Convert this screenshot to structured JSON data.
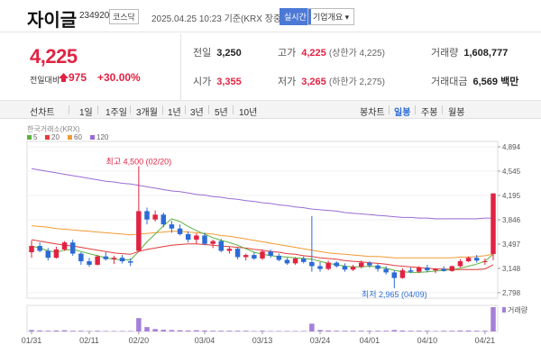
{
  "header": {
    "stock_name": "자이글",
    "stock_code": "234920",
    "market": "코스닥",
    "timestamp": "2025.04.25 10:23  기준(KRX 장중)",
    "realtime_label": "실시간",
    "company_info_label": "기업개요 ▾"
  },
  "price": {
    "current": "4,225",
    "prev_label": "전일대비",
    "change": "975",
    "change_pct": "+30.00%",
    "up_color": "#e12343"
  },
  "stats": {
    "prev_close": {
      "label": "전일",
      "value": "3,250"
    },
    "open": {
      "label": "시가",
      "value": "3,355"
    },
    "high": {
      "label": "고가",
      "value": "4,225",
      "sub": "(상한가 4,225)"
    },
    "low": {
      "label": "저가",
      "value": "3,265",
      "sub": "(하한가 2,275)"
    },
    "volume": {
      "label": "거래량",
      "value": "1,608,777"
    },
    "amount": {
      "label": "거래대금",
      "value": "6,569",
      "unit": "백만"
    }
  },
  "tabs": {
    "period": [
      "선차트",
      "1일",
      "1주일",
      "3개월",
      "1년",
      "3년",
      "5년",
      "10년"
    ],
    "candle": [
      "봉차트",
      "일봉",
      "주봉",
      "월봉"
    ],
    "active_candle": "일봉"
  },
  "chart_data": {
    "type": "candlestick",
    "source_label": "한국거래소(KRX)",
    "legend": [
      {
        "name": "5",
        "color": "#5ab33a"
      },
      {
        "name": "20",
        "color": "#e23b3b"
      },
      {
        "name": "60",
        "color": "#f39a32"
      },
      {
        "name": "120",
        "color": "#9a6bd6"
      }
    ],
    "y_ticks": [
      4894,
      4545,
      4195,
      3846,
      3497,
      3148,
      2798
    ],
    "y_tick_labels": [
      "4,894",
      "4,545",
      "4,195",
      "3,846",
      "3,497",
      "3,148",
      "2,798"
    ],
    "ylim": [
      2798,
      4894
    ],
    "x_tick_labels": [
      "01/31",
      "02/11",
      "02/20",
      "03/04",
      "03/13",
      "03/24",
      "04/01",
      "04/10",
      "04/21"
    ],
    "x_tick_index": [
      0,
      7,
      13,
      21,
      28,
      35,
      41,
      48,
      55
    ],
    "annotations": {
      "high": "최고 4,500 (02/20)",
      "low": "최저 2,965 (04/09)"
    },
    "volume_label": "거래량",
    "candles": [
      [
        3380,
        3550,
        3300,
        3470
      ],
      [
        3470,
        3520,
        3380,
        3400
      ],
      [
        3400,
        3440,
        3260,
        3300
      ],
      [
        3300,
        3460,
        3290,
        3420
      ],
      [
        3420,
        3540,
        3400,
        3520
      ],
      [
        3520,
        3560,
        3330,
        3360
      ],
      [
        3360,
        3380,
        3200,
        3250
      ],
      [
        3250,
        3300,
        3170,
        3200
      ],
      [
        3200,
        3340,
        3190,
        3320
      ],
      [
        3320,
        3380,
        3260,
        3280
      ],
      [
        3280,
        3330,
        3210,
        3300
      ],
      [
        3300,
        3340,
        3220,
        3250
      ],
      [
        3250,
        3290,
        3180,
        3230
      ],
      [
        3400,
        4500,
        3380,
        3970
      ],
      [
        3970,
        4020,
        3780,
        3850
      ],
      [
        3850,
        3980,
        3820,
        3920
      ],
      [
        3920,
        3950,
        3740,
        3780
      ],
      [
        3780,
        3830,
        3660,
        3720
      ],
      [
        3720,
        3780,
        3620,
        3640
      ],
      [
        3640,
        3680,
        3520,
        3560
      ],
      [
        3560,
        3650,
        3500,
        3620
      ],
      [
        3620,
        3660,
        3480,
        3500
      ],
      [
        3500,
        3560,
        3440,
        3540
      ],
      [
        3540,
        3570,
        3380,
        3400
      ],
      [
        3400,
        3460,
        3360,
        3430
      ],
      [
        3430,
        3450,
        3280,
        3310
      ],
      [
        3310,
        3360,
        3260,
        3340
      ],
      [
        3340,
        3380,
        3270,
        3290
      ],
      [
        3290,
        3420,
        3270,
        3390
      ],
      [
        3390,
        3420,
        3300,
        3330
      ],
      [
        3330,
        3360,
        3250,
        3270
      ],
      [
        3270,
        3300,
        3200,
        3220
      ],
      [
        3220,
        3310,
        3200,
        3290
      ],
      [
        3290,
        3320,
        3220,
        3240
      ],
      [
        3240,
        3900,
        3100,
        3180
      ],
      [
        3180,
        3240,
        3100,
        3140
      ],
      [
        3140,
        3260,
        3120,
        3230
      ],
      [
        3230,
        3250,
        3160,
        3180
      ],
      [
        3180,
        3220,
        3100,
        3130
      ],
      [
        3130,
        3200,
        3110,
        3170
      ],
      [
        3170,
        3260,
        3150,
        3230
      ],
      [
        3230,
        3250,
        3160,
        3190
      ],
      [
        3190,
        3210,
        3100,
        3140
      ],
      [
        3140,
        3180,
        3060,
        3090
      ],
      [
        3090,
        3120,
        2965,
        3010
      ],
      [
        3010,
        3150,
        3000,
        3120
      ],
      [
        3120,
        3160,
        3080,
        3100
      ],
      [
        3100,
        3180,
        3080,
        3160
      ],
      [
        3160,
        3200,
        3090,
        3120
      ],
      [
        3120,
        3150,
        3080,
        3140
      ],
      [
        3140,
        3180,
        3100,
        3110
      ],
      [
        3110,
        3190,
        3100,
        3180
      ],
      [
        3180,
        3280,
        3160,
        3250
      ],
      [
        3250,
        3320,
        3240,
        3300
      ],
      [
        3300,
        3340,
        3230,
        3260
      ],
      [
        3250,
        3290,
        3200,
        3250
      ],
      [
        3355,
        4225,
        3265,
        4225
      ]
    ],
    "volumes": [
      0.06,
      0.04,
      0.03,
      0.04,
      0.05,
      0.03,
      0.03,
      0.02,
      0.03,
      0.02,
      0.02,
      0.02,
      0.02,
      0.55,
      0.18,
      0.1,
      0.07,
      0.06,
      0.05,
      0.04,
      0.05,
      0.04,
      0.03,
      0.03,
      0.03,
      0.03,
      0.03,
      0.02,
      0.03,
      0.02,
      0.02,
      0.02,
      0.02,
      0.02,
      0.32,
      0.06,
      0.04,
      0.03,
      0.03,
      0.03,
      0.03,
      0.03,
      0.03,
      0.03,
      0.06,
      0.04,
      0.03,
      0.03,
      0.03,
      0.02,
      0.03,
      0.03,
      0.04,
      0.04,
      0.03,
      0.03,
      1.0
    ],
    "ma5": [
      3470,
      3440,
      3400,
      3380,
      3410,
      3420,
      3390,
      3360,
      3330,
      3300,
      3280,
      3270,
      3270,
      3390,
      3530,
      3640,
      3760,
      3860,
      3820,
      3750,
      3690,
      3640,
      3590,
      3550,
      3520,
      3480,
      3430,
      3380,
      3350,
      3330,
      3320,
      3310,
      3300,
      3290,
      3280,
      3250,
      3220,
      3200,
      3180,
      3170,
      3170,
      3180,
      3170,
      3150,
      3120,
      3100,
      3090,
      3090,
      3100,
      3110,
      3120,
      3130,
      3150,
      3180,
      3210,
      3250,
      3350
    ],
    "ma20": [
      3560,
      3540,
      3520,
      3500,
      3480,
      3470,
      3450,
      3430,
      3410,
      3390,
      3370,
      3360,
      3350,
      3390,
      3420,
      3440,
      3460,
      3480,
      3490,
      3500,
      3500,
      3490,
      3480,
      3470,
      3460,
      3450,
      3440,
      3420,
      3410,
      3390,
      3380,
      3360,
      3350,
      3330,
      3320,
      3300,
      3290,
      3280,
      3260,
      3250,
      3240,
      3230,
      3220,
      3210,
      3190,
      3180,
      3170,
      3160,
      3150,
      3140,
      3140,
      3130,
      3130,
      3130,
      3130,
      3140,
      3200
    ],
    "ma60": [
      3760,
      3750,
      3740,
      3720,
      3710,
      3700,
      3690,
      3680,
      3670,
      3660,
      3650,
      3640,
      3630,
      3640,
      3650,
      3660,
      3670,
      3680,
      3680,
      3670,
      3660,
      3650,
      3640,
      3620,
      3610,
      3590,
      3570,
      3550,
      3530,
      3510,
      3490,
      3470,
      3450,
      3430,
      3410,
      3390,
      3370,
      3360,
      3350,
      3340,
      3330,
      3320,
      3320,
      3310,
      3300,
      3300,
      3300,
      3300,
      3300,
      3300,
      3300,
      3300,
      3310,
      3310,
      3320,
      3330,
      3350
    ],
    "ma120": [
      4580,
      4560,
      4540,
      4520,
      4500,
      4480,
      4460,
      4440,
      4420,
      4400,
      4390,
      4370,
      4360,
      4340,
      4320,
      4300,
      4280,
      4260,
      4250,
      4230,
      4210,
      4200,
      4180,
      4170,
      4150,
      4140,
      4120,
      4110,
      4090,
      4080,
      4060,
      4050,
      4030,
      4020,
      4000,
      3990,
      3980,
      3970,
      3950,
      3940,
      3930,
      3920,
      3910,
      3900,
      3890,
      3880,
      3880,
      3870,
      3870,
      3860,
      3860,
      3860,
      3860,
      3860,
      3860,
      3870,
      3870
    ]
  }
}
